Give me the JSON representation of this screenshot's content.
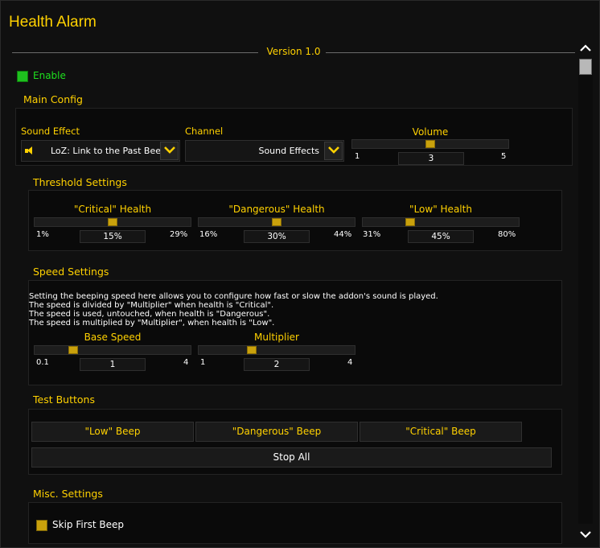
{
  "window": {
    "title": "Health Alarm",
    "version": "Version 1.0"
  },
  "enable": {
    "label": "Enable",
    "checked": true,
    "color": "#1ec01e"
  },
  "main_config": {
    "title": "Main Config",
    "sound_effect": {
      "label": "Sound Effect",
      "value": "LoZ: Link to the Past Beep"
    },
    "channel": {
      "label": "Channel",
      "value": "Sound Effects"
    },
    "volume": {
      "label": "Volume",
      "min": "1",
      "max": "5",
      "value": "3",
      "fraction": 0.5
    }
  },
  "threshold": {
    "title": "Threshold Settings",
    "sliders": [
      {
        "label": "\"Critical\" Health",
        "min": "1%",
        "max": "29%",
        "value": "15%",
        "fraction": 0.5
      },
      {
        "label": "\"Dangerous\" Health",
        "min": "16%",
        "max": "44%",
        "value": "30%",
        "fraction": 0.5
      },
      {
        "label": "\"Low\" Health",
        "min": "31%",
        "max": "80%",
        "value": "45%",
        "fraction": 0.29
      }
    ]
  },
  "speed": {
    "title": "Speed Settings",
    "description": [
      "Setting the beeping speed here allows you to configure how fast or slow the addon's sound is played.",
      "The speed is divided by \"Multiplier\" when health is \"Critical\".",
      "The speed is used, untouched, when health is \"Dangerous\".",
      "The speed is multiplied by \"Multiplier\", when health is \"Low\"."
    ],
    "base_speed": {
      "label": "Base Speed",
      "min": "0.1",
      "max": "4",
      "value": "1",
      "fraction": 0.23
    },
    "multiplier": {
      "label": "Multiplier",
      "min": "1",
      "max": "4",
      "value": "2",
      "fraction": 0.33
    }
  },
  "test_buttons": {
    "title": "Test Buttons",
    "low": "\"Low\" Beep",
    "dangerous": "\"Dangerous\" Beep",
    "critical": "\"Critical\" Beep",
    "stop": "Stop All"
  },
  "misc": {
    "title": "Misc. Settings",
    "skip_first_beep": {
      "label": "Skip First Beep",
      "checked": true
    }
  },
  "colors": {
    "accent": "#ffd100",
    "slider_thumb": "#c9a10c",
    "background": "#101010"
  },
  "icons": {
    "scroll_up": "chevron-up-icon",
    "scroll_down": "chevron-down-icon",
    "dropdown": "chevron-down-icon",
    "speaker": "speaker-icon"
  }
}
